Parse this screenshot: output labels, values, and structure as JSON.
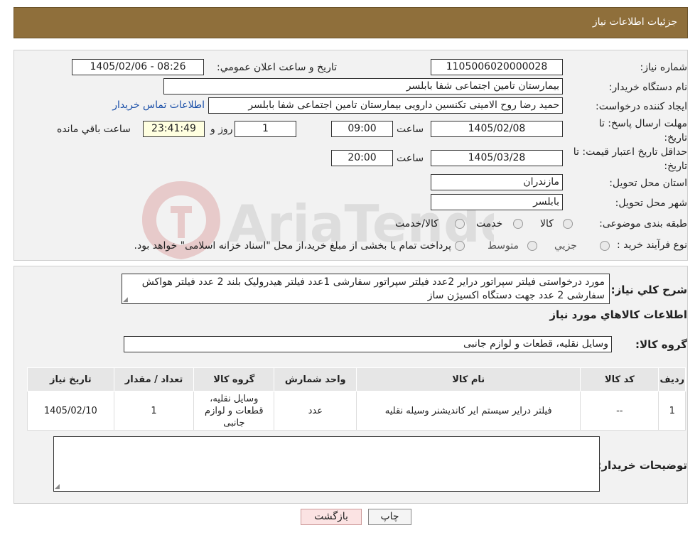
{
  "header": {
    "title": "جزئیات اطلاعات نیاز"
  },
  "watermark": {
    "text": "AriaTender.neT"
  },
  "form": {
    "need_number_label": "شماره نیاز:",
    "need_number": "1105006020000028",
    "announce_label": "تاریخ و ساعت اعلان عمومي:",
    "announce_value": "1405/02/06 - 08:26",
    "buyer_org_label": "نام دستگاه خریدار:",
    "buyer_org": "بیمارستان تامین اجتماعی شفا بابلسر",
    "creator_label": "ایجاد کننده درخواست:",
    "creator": "حمید رضا روح الامینی تکنسین دارویی بیمارستان تامین اجتماعی شفا بابلسر",
    "contact_link": "اطلاعات تماس خریدار",
    "reply_deadline_label": "مهلت ارسال پاسخ: تا تاریخ:",
    "reply_date": "1405/02/08",
    "time_label": "ساعت",
    "reply_time": "09:00",
    "days_value": "1",
    "days_label": "روز و",
    "remaining_time": "23:41:49",
    "remaining_label": "ساعت باقي مانده",
    "validity_label": "حداقل تاریخ اعتبار قیمت: تا تاریخ:",
    "validity_date": "1405/03/28",
    "validity_time": "20:00",
    "province_label": "استان محل تحویل:",
    "province": "مازندران",
    "city_label": "شهر محل تحویل:",
    "city": "بابلسر",
    "category_label": "طبقه بندی موضوعی:",
    "category_options": [
      "کالا",
      "خدمت",
      "کالا/خدمت"
    ],
    "purchase_type_label": "نوع فرآیند خرید :",
    "purchase_options": [
      "جزیي",
      "متوسط"
    ],
    "purchase_note": "پرداخت تمام یا بخشی از مبلغ خرید،از محل \"اسناد خزانه اسلامی\" خواهد بود."
  },
  "description": {
    "label": "شرح کلي نیاز:",
    "text": "مورد درخواستی فیلتر سپراتور درایر 2عدد فیلتر سپراتور سفارشی 1عدد فیلتر هیدرولیک بلند 2 عدد فیلتر هواکش سفارشی 2 عدد جهت دستگاه اکسیژن ساز",
    "items_title": "اطلاعات کالاهاي مورد نیاز",
    "group_label": "گروه کالا:",
    "group_value": "وسایل نقلیه، قطعات و لوازم جانبی"
  },
  "table": {
    "headers": [
      "ردیف",
      "کد کالا",
      "نام کالا",
      "واحد شمارش",
      "گروه کالا",
      "تعداد / مقدار",
      "تاریخ نیاز"
    ],
    "rows": [
      [
        "1",
        "--",
        "فیلتر درایر سیستم ایر کاندیشنر وسیله نقلیه",
        "عدد",
        "وسایل نقلیه، قطعات و لوازم جانبی",
        "1",
        "1405/02/10"
      ]
    ]
  },
  "notes": {
    "label": "توضیحات خریدار:",
    "value": ""
  },
  "buttons": {
    "print": "چاپ",
    "back": "بازگشت"
  },
  "colors": {
    "header": "#8f6f3b",
    "back_button": "#fbe3e3",
    "link": "#1a4fa8"
  }
}
